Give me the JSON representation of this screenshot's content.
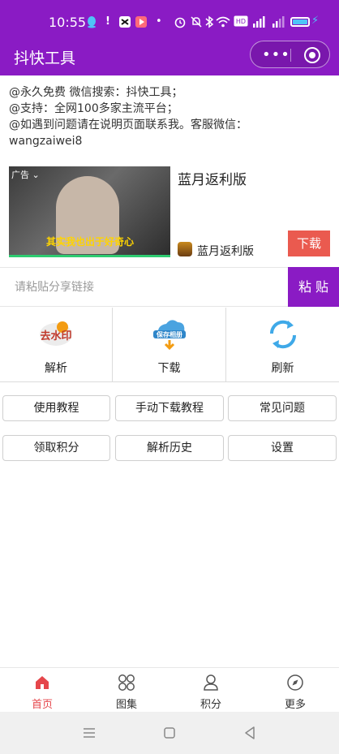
{
  "status_bar": {
    "time": "10:55",
    "icons": [
      "qq-icon",
      "alert-icon",
      "capcut-icon",
      "video-icon",
      "dot-icon",
      "alarm-icon",
      "mute-icon",
      "bluetooth-icon",
      "wifi-icon",
      "hd-icon",
      "signal-4g-icon",
      "signal-2g-icon",
      "battery-icon"
    ]
  },
  "header": {
    "title": "抖快工具",
    "menu_icon": "more-dots-icon",
    "close_icon": "target-icon",
    "color": "#8a1bc4"
  },
  "info_lines": [
    "@永久免费 微信搜索：抖快工具；",
    "@支持：全网100多家主流平台；",
    "@如遇到问题请在说明页面联系我。客服微信：",
    "wangzaiwei8"
  ],
  "ad": {
    "tag": "广告",
    "headline": "蓝月返利版",
    "app_name": "蓝月返利版",
    "download_label": "下载",
    "caption": "其实我也出于好奇心",
    "download_color": "#ea5a4f"
  },
  "paste": {
    "placeholder": "请粘贴分享链接",
    "button_label": "粘 贴"
  },
  "actions": [
    {
      "label": "解析",
      "icon": "remove-watermark-icon",
      "badge": "去水印"
    },
    {
      "label": "下载",
      "icon": "save-to-album-icon",
      "badge": "保存相册"
    },
    {
      "label": "刷新",
      "icon": "refresh-icon"
    }
  ],
  "buttons_row1": [
    "使用教程",
    "手动下载教程",
    "常见问题"
  ],
  "buttons_row2": [
    "领取积分",
    "解析历史",
    "设置"
  ],
  "tabs": [
    {
      "label": "首页",
      "icon": "home-icon",
      "active": true
    },
    {
      "label": "图集",
      "icon": "gallery-icon",
      "active": false
    },
    {
      "label": "积分",
      "icon": "user-icon",
      "active": false
    },
    {
      "label": "更多",
      "icon": "compass-icon",
      "active": false
    }
  ],
  "active_tab_color": "#e5464b"
}
